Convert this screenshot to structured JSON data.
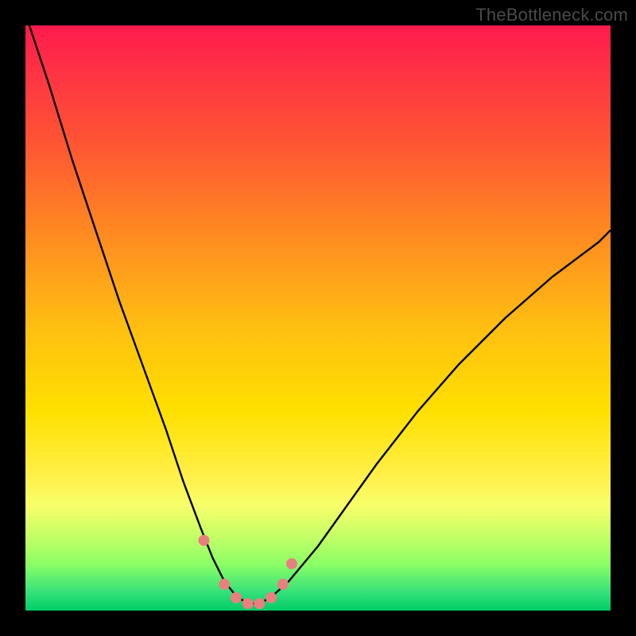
{
  "watermark": "TheBottleneck.com",
  "chart_data": {
    "type": "line",
    "title": "",
    "xlabel": "",
    "ylabel": "",
    "xlim": [
      0,
      100
    ],
    "ylim": [
      0,
      100
    ],
    "legend": false,
    "grid": false,
    "series": [
      {
        "name": "curve",
        "color": "#000000",
        "x": [
          0,
          4,
          8,
          12,
          16,
          20,
          24,
          27,
          30,
          32,
          34,
          36,
          38,
          40,
          42,
          45,
          50,
          55,
          60,
          67,
          74,
          82,
          90,
          98,
          100
        ],
        "y": [
          102,
          90,
          77,
          65,
          53,
          42,
          31,
          22,
          14,
          9,
          5,
          2.5,
          1.2,
          1.2,
          2.3,
          5,
          11,
          18,
          25,
          34,
          42,
          50,
          57,
          63,
          65
        ]
      },
      {
        "name": "markers",
        "type": "scatter",
        "color": "#e98080",
        "x": [
          30.5,
          34,
          36,
          38,
          40,
          42,
          44,
          45.5
        ],
        "y": [
          12,
          4.5,
          2.2,
          1.2,
          1.2,
          2.2,
          4.5,
          8
        ]
      }
    ]
  }
}
